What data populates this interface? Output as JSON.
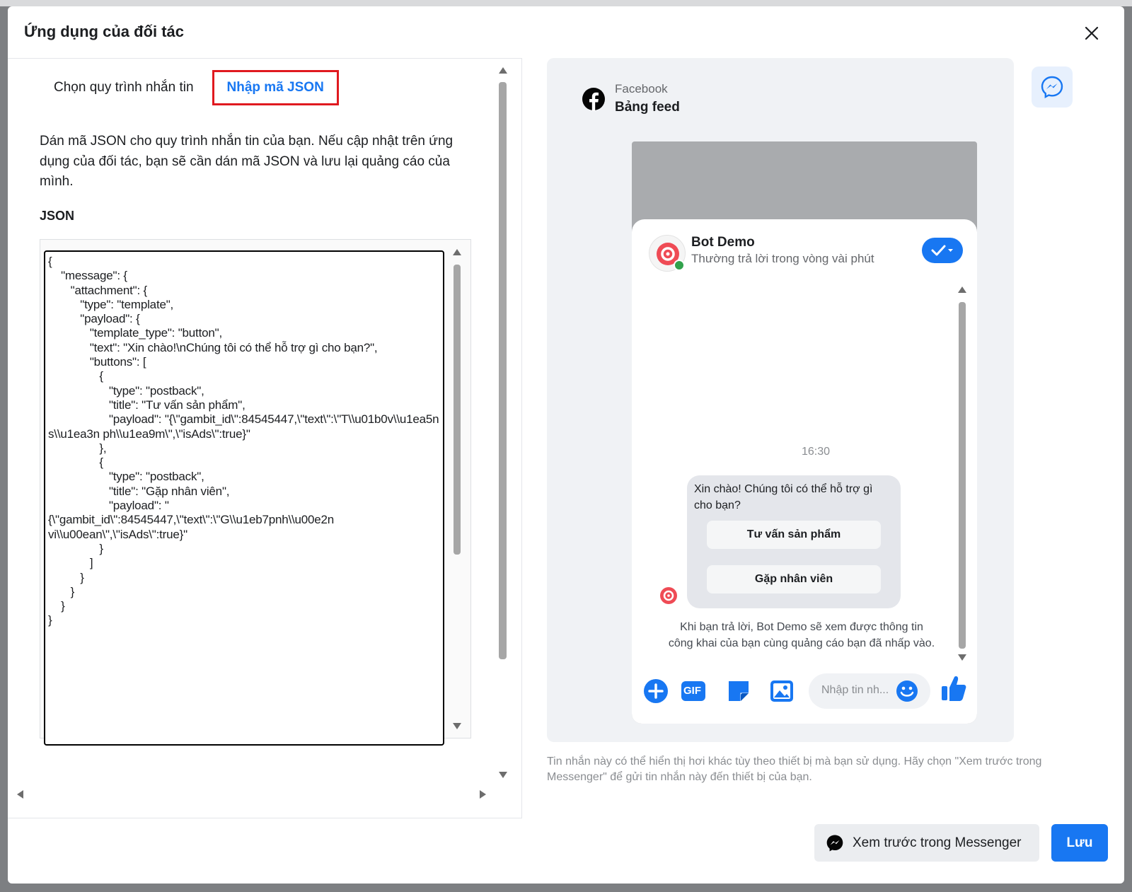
{
  "modal": {
    "title": "Ứng dụng của đối tác"
  },
  "tabs": [
    {
      "label": "Chọn quy trình nhắn tin",
      "active": false
    },
    {
      "label": "Nhập mã JSON",
      "active": true
    }
  ],
  "description": "Dán mã JSON cho quy trình nhắn tin của bạn. Nếu cập nhật trên ứng dụng của đối tác, bạn sẽ cần dán mã JSON và lưu lại quảng cáo của mình.",
  "json_label": "JSON",
  "json_value": "{\n    \"message\": {\n       \"attachment\": {\n          \"type\": \"template\",\n          \"payload\": {\n             \"template_type\": \"button\",\n             \"text\": \"Xin chào!\\nChúng tôi có thể hỗ trợ gì cho bạn?\",\n             \"buttons\": [\n                {\n                   \"type\": \"postback\",\n                   \"title\": \"Tư vấn sản phẩm\",\n                   \"payload\": \"{\\\"gambit_id\\\":84545447,\\\"text\\\":\\\"T\\\\u01b0v\\\\u1ea5n s\\\\u1ea3n ph\\\\u1ea9m\\\",\\\"isAds\\\":true}\"\n                },\n                {\n                   \"type\": \"postback\",\n                   \"title\": \"Gặp nhân viên\",\n                   \"payload\": \"{\\\"gambit_id\\\":84545447,\\\"text\\\":\\\"G\\\\u1eb7pnh\\\\u00e2n vi\\\\u00ean\\\",\\\"isAds\\\":true}\"\n                }\n             ]\n          }\n       }\n    }\n}",
  "preview": {
    "source": "Facebook",
    "placement": "Bảng feed",
    "bot_name": "Bot Demo",
    "bot_status": "Thường trả lời trong vòng vài phút",
    "timestamp": "16:30",
    "message_text": "Xin chào! Chúng tôi có thể hỗ trợ gì cho bạn?",
    "buttons": [
      "Tư vấn sản phẩm",
      "Gặp nhân viên"
    ],
    "privacy_note": "Khi bạn trả lời, Bot Demo sẽ xem được thông tin công khai của bạn cùng quảng cáo bạn đã nhấp vào.",
    "composer_placeholder": "Nhập tin nh...",
    "gif_label": "GIF"
  },
  "preview_note": "Tin nhắn này có thể hiển thị hơi khác tùy theo thiết bị mà bạn sử dụng. Hãy chọn \"Xem trước trong Messenger\" để gửi tin nhắn này đến thiết bị của bạn.",
  "footer": {
    "preview_button": "Xem trước trong Messenger",
    "save_button": "Lưu"
  },
  "colors": {
    "brand": "#1877f2",
    "highlight": "#e0191f",
    "online": "#31a24c"
  }
}
